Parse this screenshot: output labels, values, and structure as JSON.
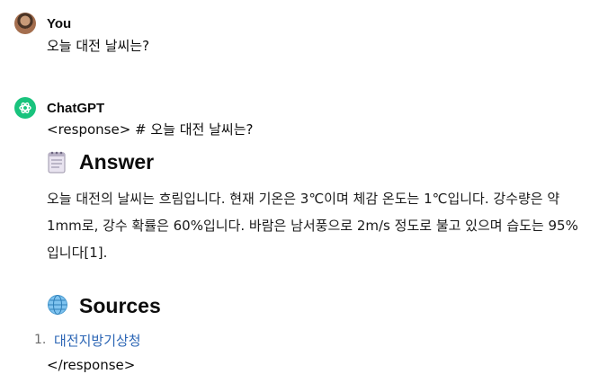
{
  "user_message": {
    "author": "You",
    "text": "오늘 대전 날씨는?"
  },
  "assistant_message": {
    "author": "ChatGPT",
    "open_tag": "<response> # 오늘 대전 날씨는?",
    "answer_heading": "Answer",
    "answer_icon": "notepad-icon",
    "answer_text": "오늘 대전의 날씨는 흐림입니다. 현재 기온은 3℃이며 체감 온도는 1℃입니다. 강수량은 약 1mm로, 강수 확률은 60%입니다. 바람은 남서풍으로 2m/s 정도로 불고 있으며 습도는 95%입니다[1].",
    "sources_heading": "Sources",
    "sources_icon": "globe-icon",
    "sources": [
      {
        "num": "1.",
        "label": "대전지방기상청"
      }
    ],
    "close_tag": "</response>"
  },
  "colors": {
    "chatgpt_brand": "#19c37d",
    "link": "#2a64b4"
  }
}
